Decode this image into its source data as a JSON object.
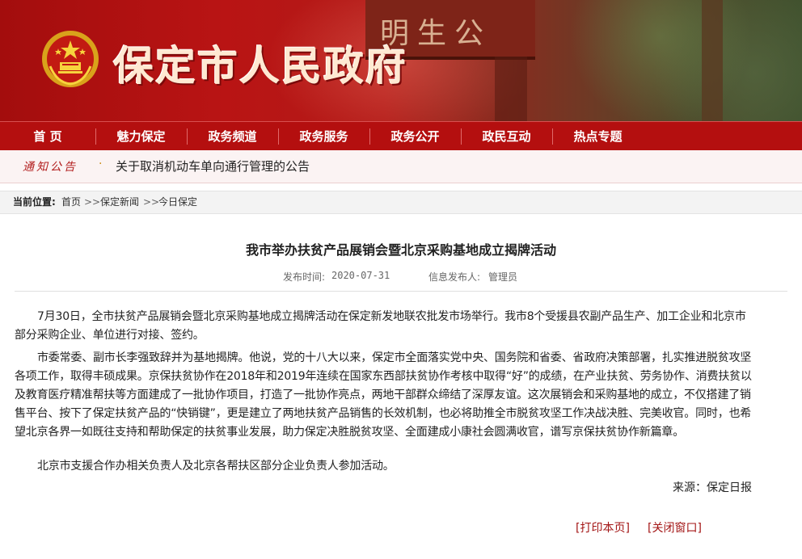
{
  "header": {
    "site_title": "保定市人民政府",
    "gate_text": "明生公"
  },
  "nav": {
    "items": [
      "首 页",
      "魅力保定",
      "政务频道",
      "政务服务",
      "政务公开",
      "政民互动",
      "热点专题"
    ]
  },
  "notice": {
    "label": "通知公告",
    "bullet": "·",
    "text": "关于取消机动车单向通行管理的公告"
  },
  "breadcrumb": {
    "label": "当前位置:",
    "items": [
      "首页",
      "保定新闻",
      "今日保定"
    ],
    "separator": ">>"
  },
  "article": {
    "title": "我市举办扶贫产品展销会暨北京采购基地成立揭牌活动",
    "date_label": "发布时间:",
    "date": "2020-07-31",
    "publisher_label": "信息发布人:",
    "publisher": "管理员",
    "paragraphs": [
      "7月30日，全市扶贫产品展销会暨北京采购基地成立揭牌活动在保定新发地联农批发市场举行。我市8个受援县农副产品生产、加工企业和北京市部分采购企业、单位进行对接、签约。",
      "市委常委、副市长李强致辞并为基地揭牌。他说，党的十八大以来，保定市全面落实党中央、国务院和省委、省政府决策部署，扎实推进脱贫攻坚各项工作，取得丰硕成果。京保扶贫协作在2018年和2019年连续在国家东西部扶贫协作考核中取得“好”的成绩，在产业扶贫、劳务协作、消费扶贫以及教育医疗精准帮扶等方面建成了一批协作项目，打造了一批协作亮点，两地干部群众缔结了深厚友谊。这次展销会和采购基地的成立，不仅搭建了销售平台、按下了保定扶贫产品的“快销键”，更是建立了两地扶贫产品销售的长效机制，也必将助推全市脱贫攻坚工作决战决胜、完美收官。同时，也希望北京各界一如既往支持和帮助保定的扶贫事业发展，助力保定决胜脱贫攻坚、全面建成小康社会圆满收官，谱写京保扶贫协作新篇章。",
      "北京市支援合作办相关负责人及北京各帮扶区部分企业负责人参加活动。"
    ],
    "source": "来源：保定日报"
  },
  "actions": {
    "print": "打印本页",
    "close": "关闭窗口",
    "open_bracket": "[",
    "close_bracket": "]"
  },
  "colors": {
    "nav_bg": "#b40f0f",
    "accent": "#a31515",
    "notice_bg": "#fbf3f3"
  }
}
